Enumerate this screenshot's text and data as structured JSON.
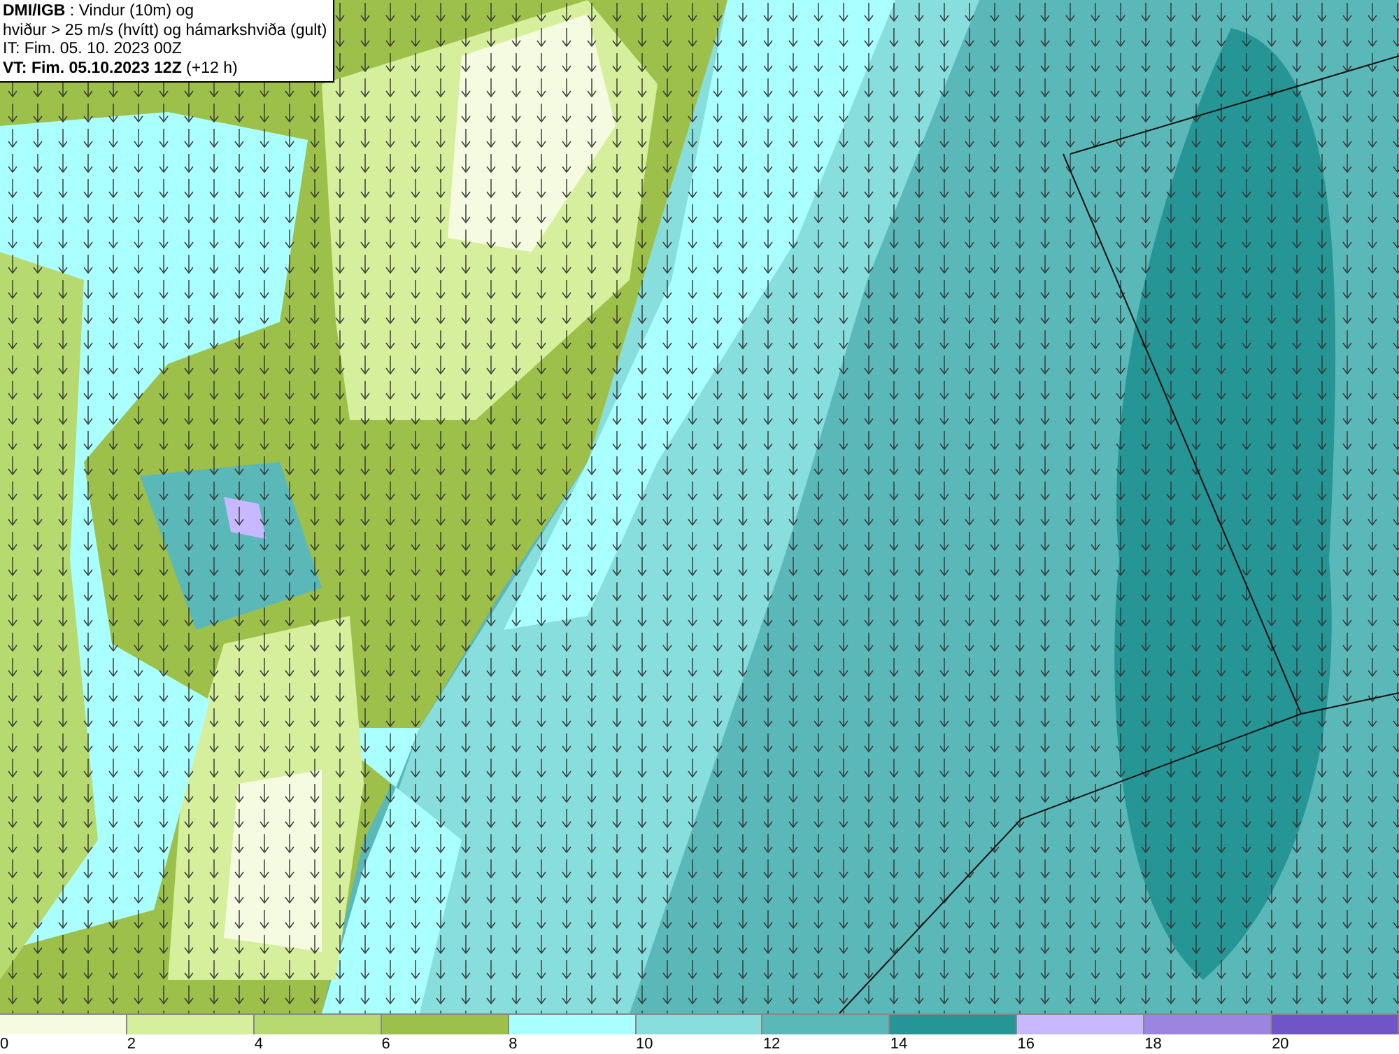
{
  "header": {
    "lines": [
      "**DMI/IGB** : Vindur (10m) og",
      "hviður > 25 m/s (hvítt) og hámarkshviða (gult)",
      "IT: Fim. 05. 10. 2023 00Z",
      "**VT: Fim. 05.10.2023 12Z** (+12 h)"
    ]
  },
  "legend": [
    {
      "label": "0",
      "color": "#f5fbe0"
    },
    {
      "label": "2",
      "color": "#d6ef9c"
    },
    {
      "label": "4",
      "color": "#b6d970"
    },
    {
      "label": "6",
      "color": "#9cc04a"
    },
    {
      "label": "8",
      "color": "#aaffff"
    },
    {
      "label": "10",
      "color": "#88dddd"
    },
    {
      "label": "12",
      "color": "#5bb8b8"
    },
    {
      "label": "14",
      "color": "#269595"
    },
    {
      "label": "16",
      "color": "#c8b8ff"
    },
    {
      "label": "18",
      "color": "#9b85e0"
    },
    {
      "label": "20",
      "color": "#7055c8"
    }
  ]
}
